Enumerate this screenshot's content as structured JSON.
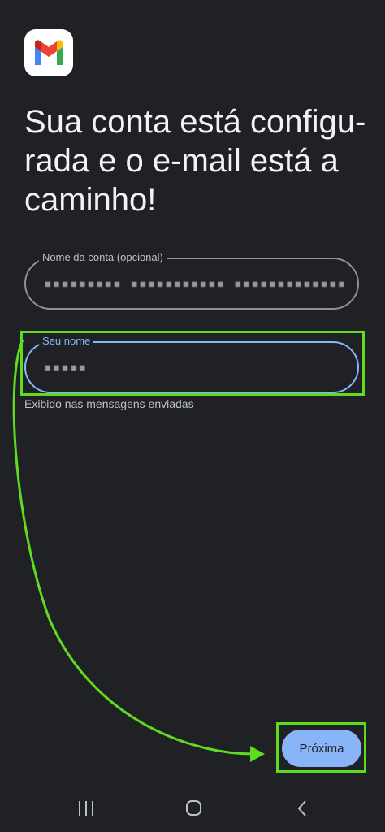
{
  "app": {
    "logo_icon": "gmail-logo-icon"
  },
  "header": {
    "title_lines": [
      "Sua conta está configu-",
      "rada e o e-mail está a",
      "caminho!"
    ]
  },
  "form": {
    "account_name": {
      "label": "Nome da conta (opcional)",
      "value": "▪▪▪▪▪▪▪▪▪ ▪▪▪▪▪▪▪▪▪▪▪ ▪▪▪▪▪▪▪▪▪▪▪▪▪ ▪▪▪▪"
    },
    "your_name": {
      "label": "Seu nome",
      "value": "▪▪▪▪▪",
      "helper": "Exibido nas mensagens enviadas"
    }
  },
  "actions": {
    "next_label": "Próxima"
  },
  "nav": {
    "recent_icon": "recent-apps-icon",
    "home_icon": "home-icon",
    "back_icon": "back-icon"
  },
  "colors": {
    "background": "#202124",
    "accent": "#8ab4f8",
    "annotation": "#5fdc1e"
  }
}
